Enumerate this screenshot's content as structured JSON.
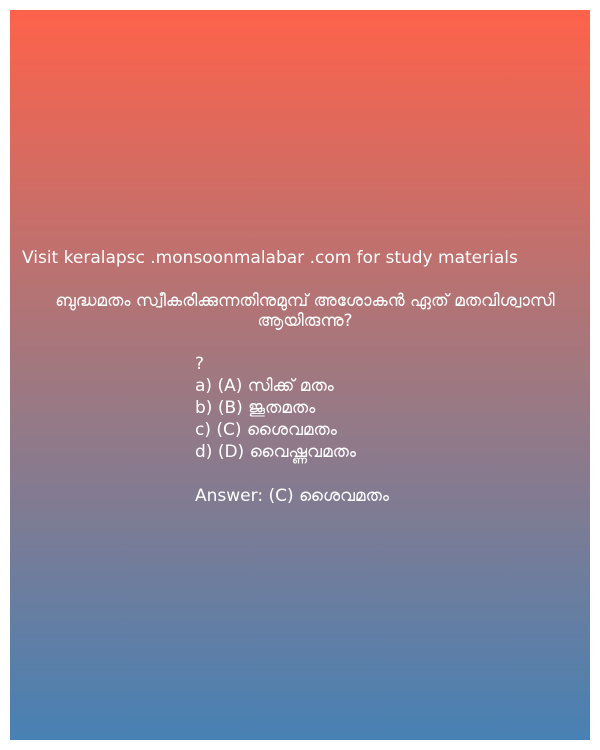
{
  "visit_line": "Visit keralapsc .monsoonmalabar .com for study materials",
  "question": "ബുദ്ധമതം സ്വീകരിക്കുന്നതിനുമുമ്പ് അശോകൻ ഏത് മതവിശ്വാസി ആയിരുന്നു?",
  "question_mark": "?",
  "options": [
    "a) (A) സിക്ക് മതം",
    "b) (B) ജൂതമതം",
    "c) (C) ശൈവമതം",
    "d) (D) വൈഷ്ണവമതം"
  ],
  "answer": "Answer: (C) ശൈവമതം",
  "colors": {
    "gradient_top": "#fe624a",
    "gradient_mid": "#a07880",
    "gradient_bottom": "#4781b4",
    "text": "#ffffff"
  }
}
